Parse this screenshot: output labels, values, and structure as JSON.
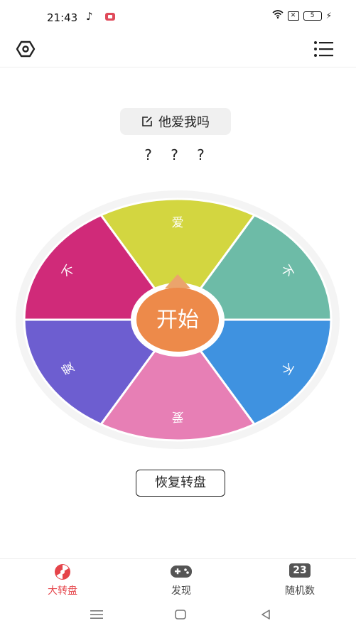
{
  "status": {
    "time": "21:43",
    "battery": "5"
  },
  "topic": {
    "title": "他爱我吗"
  },
  "result": "? ? ?",
  "wheel": {
    "center_label": "开始",
    "segments": [
      {
        "label": "爱",
        "color": "#d3d640"
      },
      {
        "label": "不",
        "color": "#6dbba7"
      },
      {
        "label": "不",
        "color": "#3f92e0"
      },
      {
        "label": "爱",
        "color": "#e77fb5"
      },
      {
        "label": "爱",
        "color": "#6d5ed0"
      },
      {
        "label": "不",
        "color": "#d02a79"
      }
    ],
    "pointer_color": "#eba46c",
    "center_color": "#ed8a4a"
  },
  "reset_label": "恢复转盘",
  "tabs": [
    {
      "label": "大转盘",
      "icon": "wheel-icon",
      "active": true
    },
    {
      "label": "发现",
      "icon": "gamepad-icon",
      "active": false
    },
    {
      "label": "随机数",
      "icon": "number-icon",
      "badge": "23",
      "active": false
    }
  ],
  "accent_color": "#e5444a"
}
